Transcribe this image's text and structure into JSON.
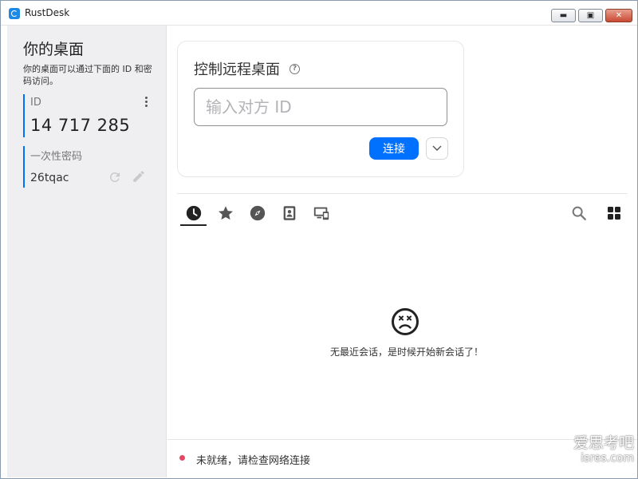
{
  "window": {
    "title": "RustDesk",
    "controls": {
      "minimize": "▬",
      "maximize": "▣",
      "close": "✕"
    }
  },
  "sidebar": {
    "title": "你的桌面",
    "description": "你的桌面可以通过下面的 ID 和密码访问。",
    "id_label": "ID",
    "id_value": "14 717 285",
    "password_label": "一次性密码",
    "password_value": "26tqac",
    "icons": [
      "more-vert-icon",
      "refresh-icon",
      "edit-icon"
    ]
  },
  "connect": {
    "title": "控制远程桌面",
    "help_icon": "?",
    "input_placeholder": "输入对方 ID",
    "input_value": "",
    "connect_label": "连接",
    "accent": "#0071ff"
  },
  "tabs": [
    {
      "icon": "recent-clock-icon",
      "active": true
    },
    {
      "icon": "favorites-star-icon",
      "active": false
    },
    {
      "icon": "discovered-compass-icon",
      "active": false
    },
    {
      "icon": "address-book-icon",
      "active": false
    },
    {
      "icon": "devices-icon",
      "active": false
    }
  ],
  "toolbar_icons": [
    "search-icon",
    "grid-view-icon"
  ],
  "empty_state": {
    "icon": "sad-face-icon",
    "message": "无最近会话，是时候开始新会话了！"
  },
  "status": {
    "color": "#e34a62",
    "text": "未就绪，请检查网络连接"
  },
  "watermark": {
    "line1": "爱思考吧",
    "line2": "isres.com"
  }
}
